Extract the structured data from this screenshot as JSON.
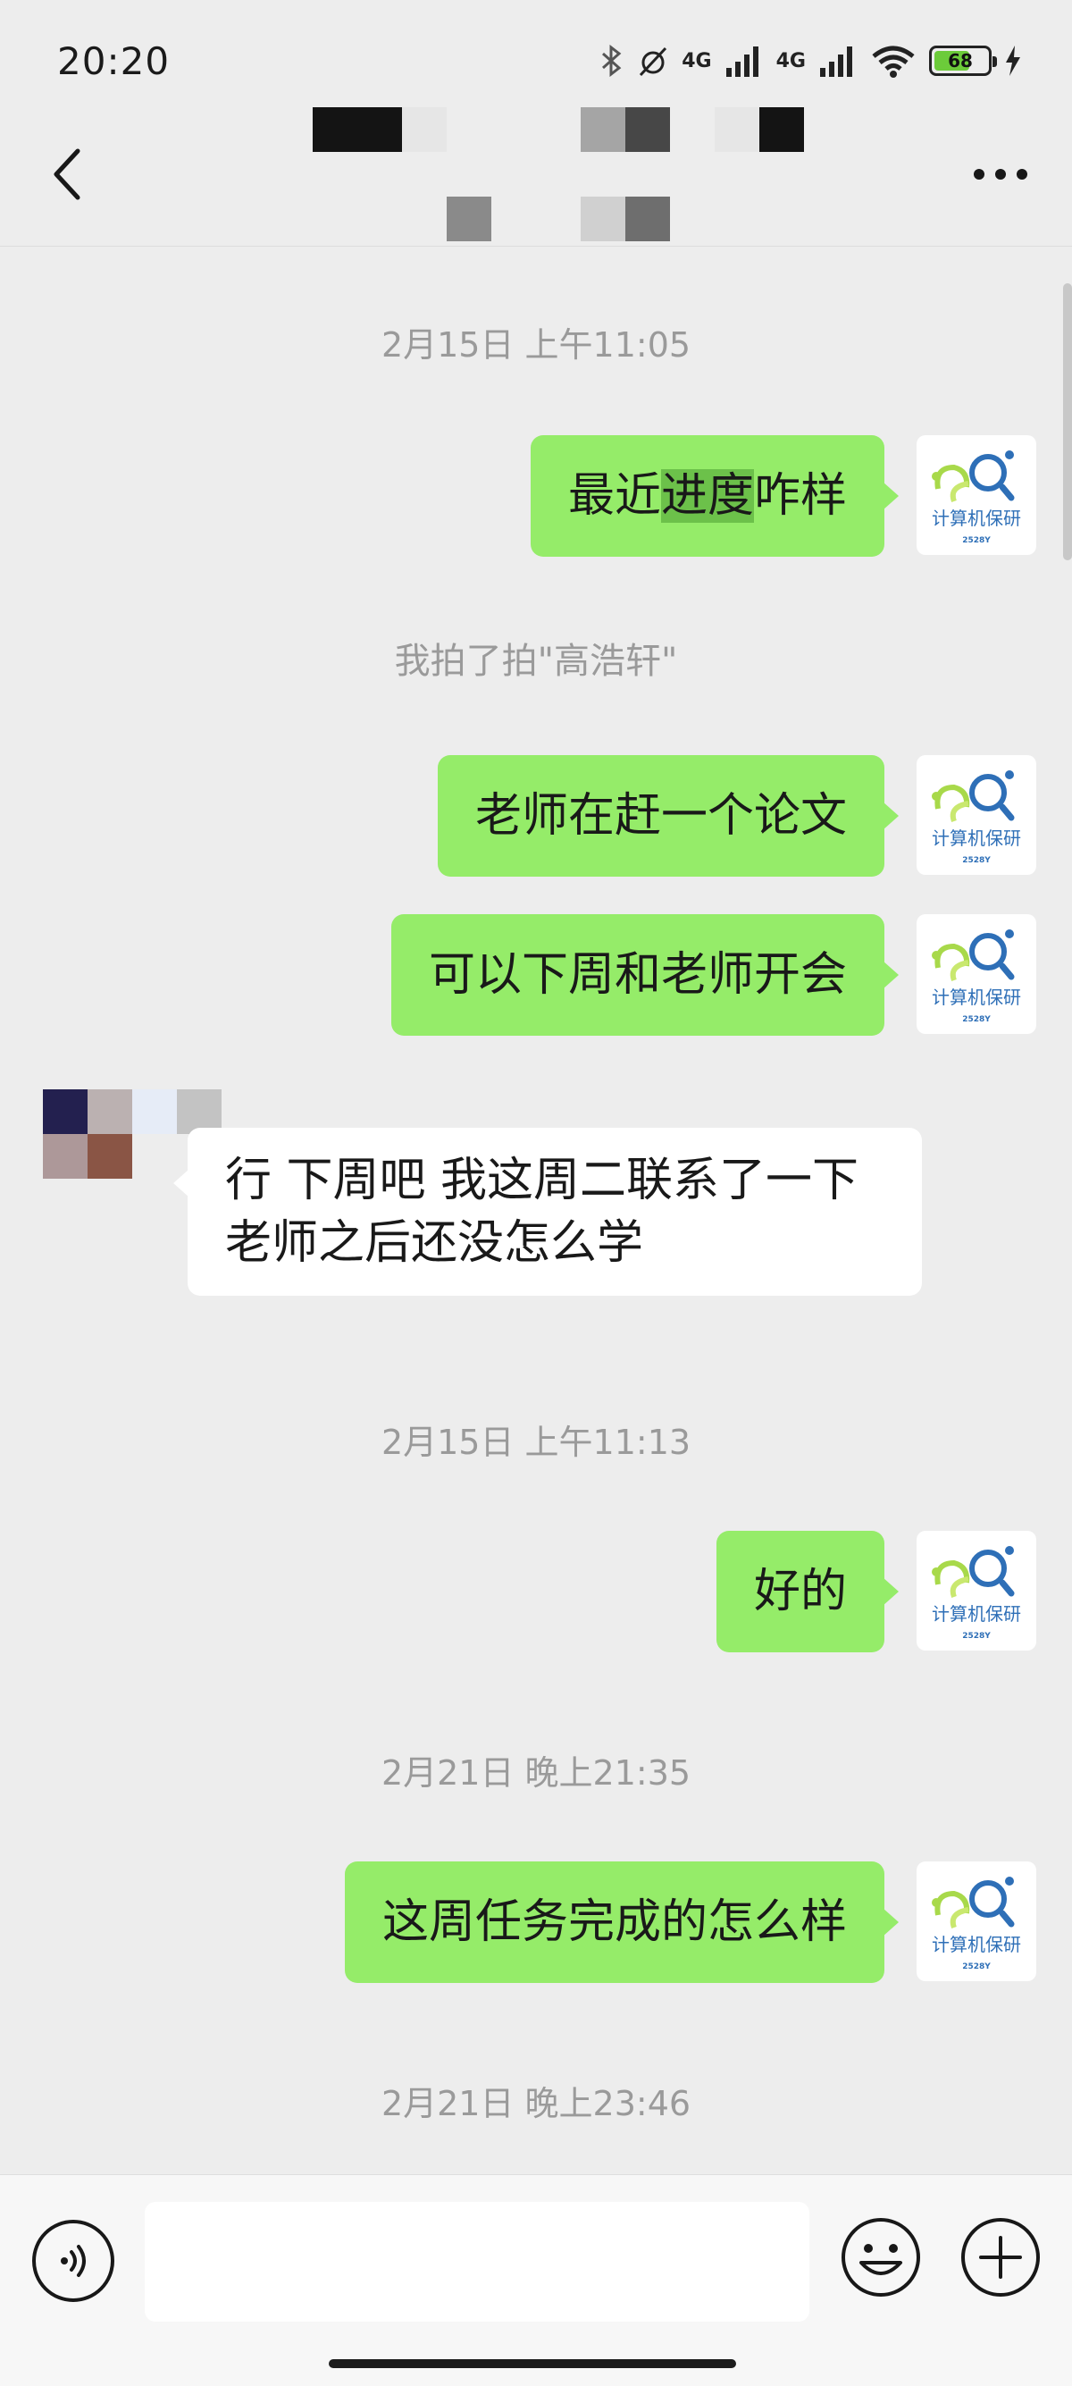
{
  "status_bar": {
    "time": "20:20",
    "network_1": "4G",
    "network_2": "4G",
    "wifi_label": "6",
    "battery": "68"
  },
  "nav": {
    "back_icon": "chevron-left-icon",
    "more_icon": "ellipsis-icon"
  },
  "colors": {
    "outgoing_bubble": "#95ec69",
    "incoming_bubble": "#ffffff",
    "background": "#ededed",
    "highlight": "#6cc14a"
  },
  "avatar_me": {
    "label": "计算机保研",
    "sublabel": "2528Y"
  },
  "messages": [
    {
      "type": "timestamp",
      "text": "2月15日 上午11:05"
    },
    {
      "type": "outgoing",
      "pre": "最近",
      "highlight": "进度",
      "post": "咋样"
    },
    {
      "type": "system",
      "text": "我拍了拍\"高浩轩\""
    },
    {
      "type": "outgoing",
      "text": "老师在赶一个论文"
    },
    {
      "type": "outgoing",
      "text": "可以下周和老师开会"
    },
    {
      "type": "incoming",
      "text": "行 下周吧 我这周二联系了一下老师之后还没怎么学"
    },
    {
      "type": "timestamp",
      "text": "2月15日 上午11:13"
    },
    {
      "type": "outgoing",
      "text": "好的"
    },
    {
      "type": "timestamp",
      "text": "2月21日 晚上21:35"
    },
    {
      "type": "outgoing",
      "text": "这周任务完成的怎么样"
    },
    {
      "type": "timestamp",
      "text": "2月21日 晚上23:46"
    }
  ],
  "input_bar": {
    "placeholder": "",
    "voice_icon": "voice-icon",
    "emoji_icon": "emoji-icon",
    "plus_icon": "plus-icon"
  }
}
